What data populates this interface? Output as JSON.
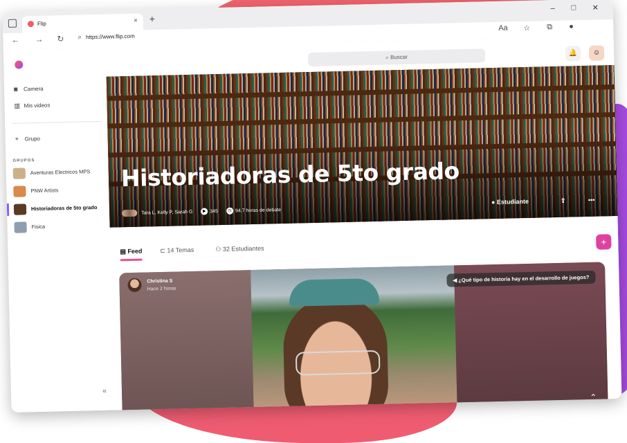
{
  "browser": {
    "tab_title": "Flip",
    "tab_close": "×",
    "new_tab": "+",
    "url": "https://www.flip.com",
    "window_controls": [
      "–",
      "□",
      "✕"
    ]
  },
  "app": {
    "search_placeholder": "Buscar",
    "sidebar": {
      "items": [
        {
          "icon": "camera-icon",
          "label": "Camera"
        },
        {
          "icon": "videos-icon",
          "label": "Mis videos"
        }
      ],
      "add_group_label": "Grupo",
      "groups_heading": "GRUPOS",
      "groups": [
        {
          "label": "Aventuras Electricos MPS",
          "color": "#c9b28a"
        },
        {
          "label": "PNW Artists",
          "color": "#d98a4a"
        },
        {
          "label": "Historiadoras de 5to grado",
          "color": "#5a3a22",
          "active": true
        },
        {
          "label": "Fisica",
          "color": "#8f9db0"
        }
      ],
      "collapse": "«"
    },
    "hero": {
      "title": "Historiadoras de 5to grado",
      "members": "Tara L, Kelly P, Sarah G",
      "videos_count": "345",
      "hours": "94.7 horas de debate",
      "role": "Estudiante"
    },
    "tabs": [
      {
        "label": "Feed",
        "active": true
      },
      {
        "label": "14 Temas"
      },
      {
        "label": "32 Estudiantes"
      }
    ],
    "add_button": "+",
    "post": {
      "author": "Christina S",
      "time": "Hace 2 horas",
      "topic": "¿Qué tipo de historia hay en el desarrollo de juegos?"
    }
  },
  "colors": {
    "accent": "#e040a0",
    "brand_pink": "#f25c6a",
    "brand_purple": "#a64be0"
  }
}
